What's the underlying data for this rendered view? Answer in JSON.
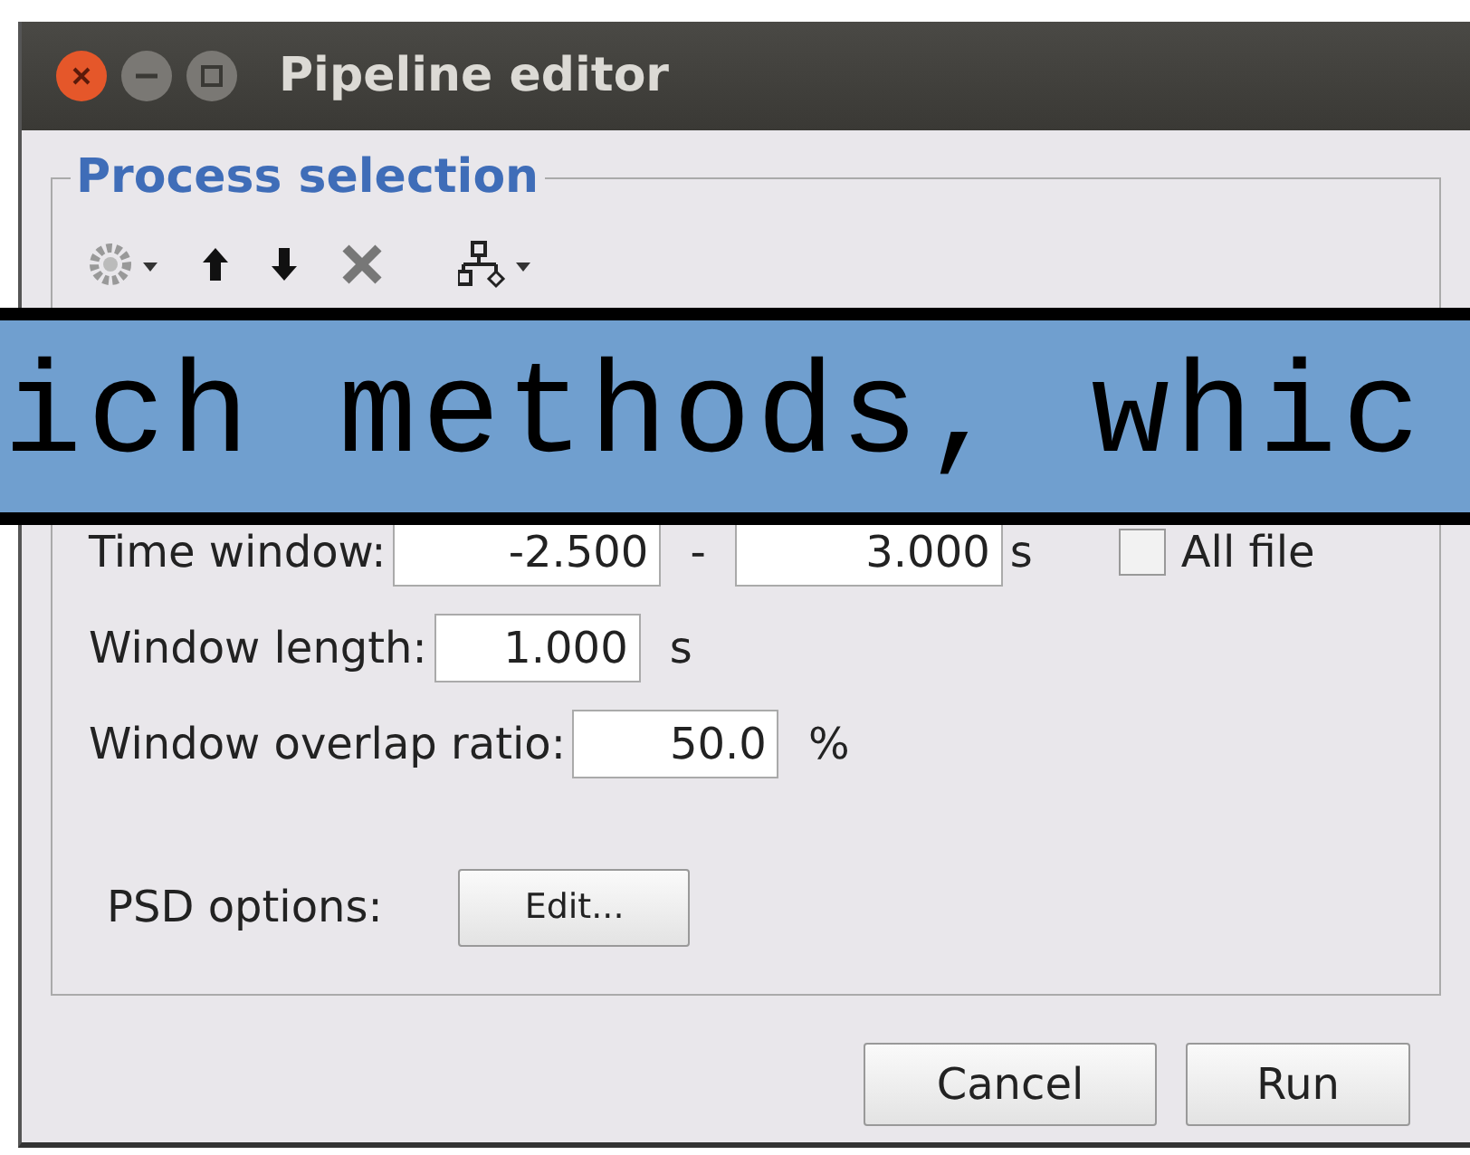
{
  "window": {
    "title": "Pipeline editor"
  },
  "panel": {
    "title": "Process selection"
  },
  "caption": "ich methods, whic",
  "time_window": {
    "label": "Time window:",
    "start": "-2.500",
    "separator": "-",
    "end": "3.000",
    "unit": "s",
    "all_file": {
      "label": "All file",
      "checked": false
    }
  },
  "window_length": {
    "label": "Window length:",
    "value": "1.000",
    "unit": "s"
  },
  "overlap": {
    "label": "Window overlap ratio:",
    "value": "50.0",
    "unit": "%"
  },
  "psd": {
    "label": "PSD options:",
    "button": "Edit..."
  },
  "buttons": [
    "Cancel",
    "Run"
  ]
}
